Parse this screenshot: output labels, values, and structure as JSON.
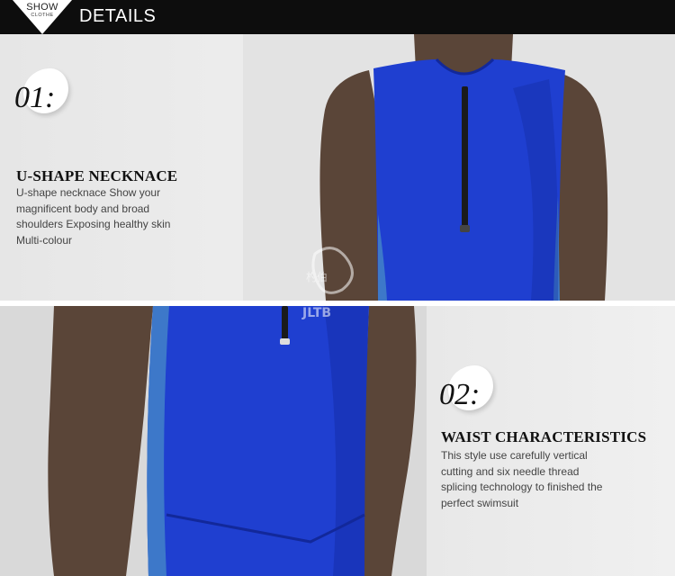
{
  "header": {
    "badge_top": "SHOW",
    "badge_bottom": "CLOTHE",
    "title": "DETAILS"
  },
  "features": [
    {
      "number": "01:",
      "title": "U-SHAPE NECKNACE",
      "description": "U-shape necknace Show your magnificent body and broad shoulders Exposing healthy skin Multi-colour"
    },
    {
      "number": "02:",
      "title": "WAIST CHARACTERISTICS",
      "description": "This style use carefully vertical cutting and six needle thread splicing technology  to finished the perfect swimsuit"
    }
  ],
  "watermark": {
    "text_cn": "杓伯",
    "brand": "JLTB"
  },
  "colors": {
    "suit": "#1f3fd0",
    "suit_dark": "#12289a",
    "suit_panel": "#3d78c9",
    "skin": "#5a4538",
    "header_bg": "#0d0d0d"
  }
}
